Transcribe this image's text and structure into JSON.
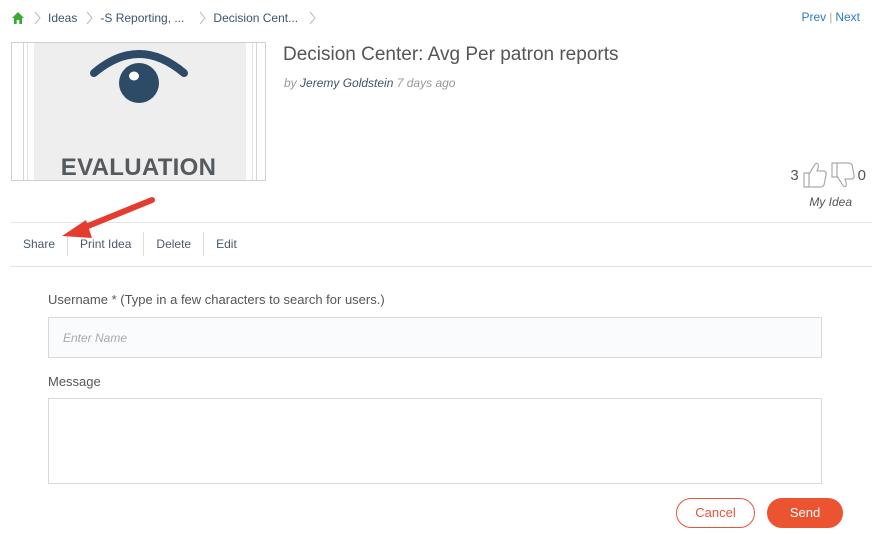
{
  "breadcrumb": {
    "items": [
      {
        "label": "Ideas"
      },
      {
        "label": "-S Reporting, ..."
      },
      {
        "label": "Decision Cent..."
      }
    ]
  },
  "pager": {
    "prev": "Prev",
    "separator": "|",
    "next": "Next"
  },
  "thumbnail": {
    "caption": "EVALUATION"
  },
  "idea": {
    "title": "Decision Center: Avg Per patron reports",
    "by_prefix": "by",
    "author": "Jeremy Goldstein",
    "age": "7 days ago"
  },
  "votes": {
    "up": "3",
    "down": "0",
    "my_idea": "My Idea"
  },
  "actions": {
    "share": "Share",
    "print": "Print Idea",
    "delete": "Delete",
    "edit": "Edit"
  },
  "form": {
    "username_label": "Username * (Type in a few characters to search for users.)",
    "username_placeholder": "Enter Name",
    "message_label": "Message",
    "cancel": "Cancel",
    "send": "Send"
  },
  "colors": {
    "accent": "#ec5330",
    "link": "#2a7cc0",
    "eye": "#2d4a66",
    "home": "#3aa935"
  }
}
